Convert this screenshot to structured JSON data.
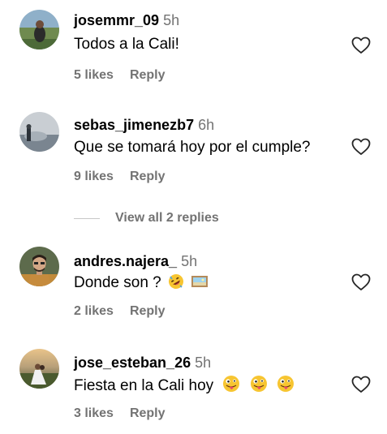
{
  "comments": [
    {
      "username": "josemmr_09",
      "time": "5h",
      "text": "Todos a la Cali!",
      "likes": "5 likes",
      "reply": "Reply"
    },
    {
      "username": "sebas_jimenezb7",
      "time": "6h",
      "text": "Que se tomará hoy por el cumple?",
      "likes": "9 likes",
      "reply": "Reply"
    },
    {
      "username": "andres.najera_",
      "time": "5h",
      "text": "Donde son ?",
      "likes": "2 likes",
      "reply": "Reply"
    },
    {
      "username": "jose_esteban_26",
      "time": "5h",
      "text": "Fiesta en la Cali hoy",
      "likes": "3 likes",
      "reply": "Reply"
    }
  ],
  "view_replies_label": "View all 2 replies",
  "icons": {
    "like": "heart-outline-icon",
    "emoji_rofl": "rolling-on-floor-laughing-emoji",
    "emoji_image": "framed-picture-emoji",
    "emoji_tongue": "zany-face-emoji"
  },
  "colors": {
    "text": "#000000",
    "secondary": "#737373",
    "divider": "#c7c7c7"
  }
}
